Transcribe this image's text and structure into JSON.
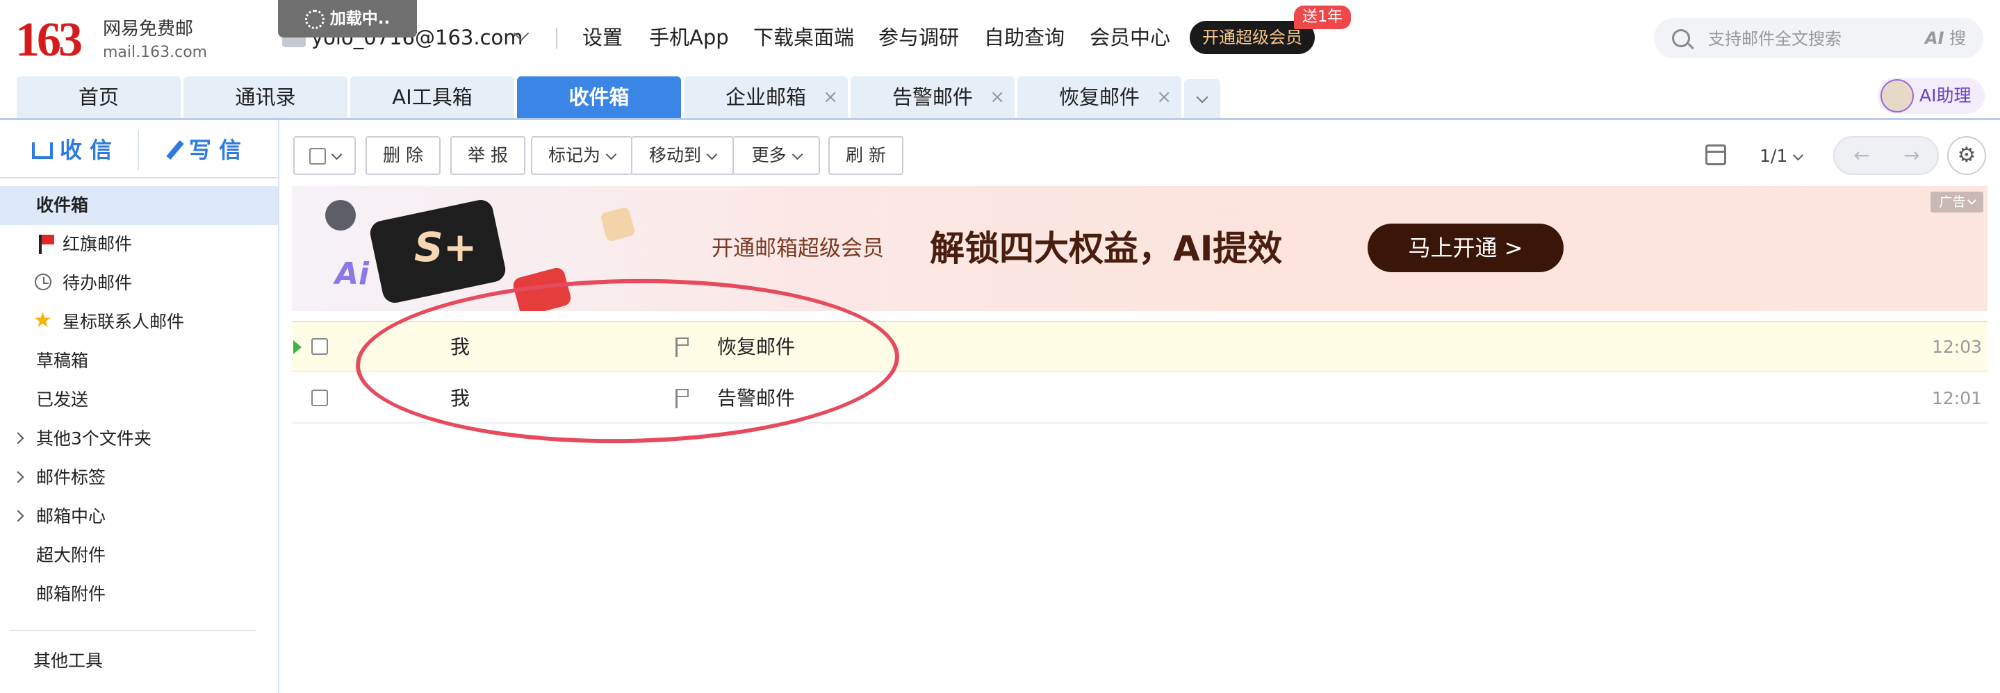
{
  "header": {
    "logo_number": "163",
    "logo_name": "网易免费邮",
    "logo_domain": "mail.163.com",
    "loading_text": "加载中..",
    "account": "yolo_0716@163.com",
    "links": [
      "设置",
      "手机App",
      "下载桌面端",
      "参与调研",
      "自助查询",
      "会员中心"
    ],
    "vip_button": "开通超级会员",
    "vip_badge": "送1年",
    "search_placeholder": "支持邮件全文搜索",
    "ai_search_prefix": "AI",
    "ai_search_label": "搜"
  },
  "tabs": [
    {
      "label": "首页",
      "closable": false,
      "active": false
    },
    {
      "label": "通讯录",
      "closable": false,
      "active": false
    },
    {
      "label": "AI工具箱",
      "closable": false,
      "active": false
    },
    {
      "label": "收件箱",
      "closable": false,
      "active": true
    },
    {
      "label": "企业邮箱",
      "closable": true,
      "active": false
    },
    {
      "label": "告警邮件",
      "closable": true,
      "active": false
    },
    {
      "label": "恢复邮件",
      "closable": true,
      "active": false
    }
  ],
  "tab_close_glyph": "×",
  "ai_assistant_label": "AI助理",
  "sidebar": {
    "receive_label": "收 信",
    "compose_label": "写 信",
    "items": [
      {
        "label": "收件箱"
      },
      {
        "label": "红旗邮件"
      },
      {
        "label": "待办邮件"
      },
      {
        "label": "星标联系人邮件"
      },
      {
        "label": "草稿箱"
      },
      {
        "label": "已发送"
      },
      {
        "label": "其他3个文件夹"
      },
      {
        "label": "邮件标签"
      },
      {
        "label": "邮箱中心"
      },
      {
        "label": "超大附件"
      },
      {
        "label": "邮箱附件"
      }
    ],
    "other_tools": "其他工具"
  },
  "toolbar": {
    "delete": "删 除",
    "report": "举 报",
    "mark_as": "标记为",
    "move_to": "移动到",
    "more": "更多",
    "refresh": "刷 新",
    "page": "1/1",
    "prev": "←",
    "next": "→"
  },
  "banner": {
    "subtitle": "开通邮箱超级会员",
    "headline": "解锁四大权益，AI提效",
    "cta": "马上开通 >",
    "ad_tag": "广告"
  },
  "mails": [
    {
      "sender": "我",
      "subject": "恢复邮件",
      "time": "12:03",
      "unread": true
    },
    {
      "sender": "我",
      "subject": "告警邮件",
      "time": "12:01",
      "unread": false
    }
  ],
  "colors": {
    "brand_red": "#d51b1b",
    "active_tab": "#3b85e6",
    "annotation_oval": "#e64a5c"
  }
}
